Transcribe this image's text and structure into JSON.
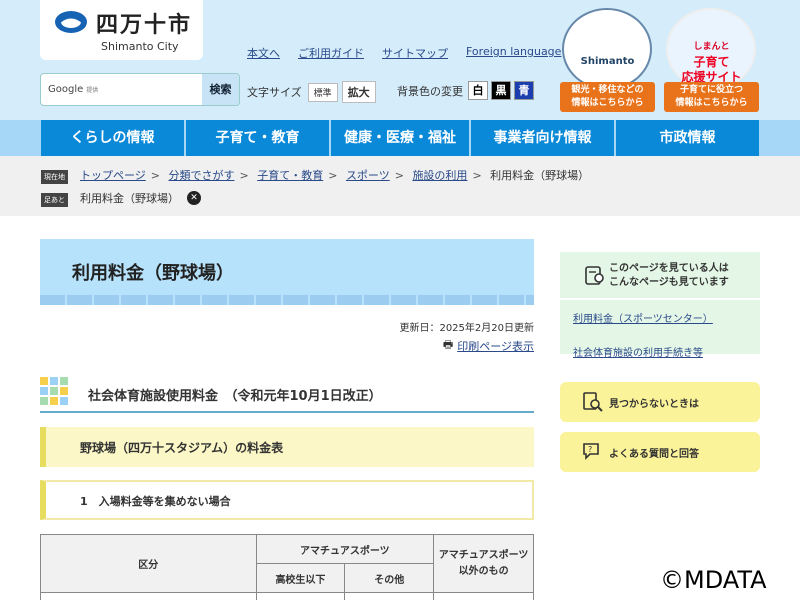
{
  "header": {
    "logo_jp": "四万十市",
    "logo_en": "Shimanto City",
    "links": [
      "本文へ",
      "ご利用ガイド",
      "サイトマップ",
      "Foreign language"
    ],
    "search_brand": "Google",
    "search_brand_sub": "提供",
    "search_button": "検索",
    "fontsize_label": "文字サイズ",
    "fontsize_normal": "標準",
    "fontsize_large": "拡大",
    "bgcolor_label": "背景色の変更",
    "bgcolor_white": "白",
    "bgcolor_black": "黒",
    "bgcolor_blue": "青",
    "banner1_line1": "観光・移住などの",
    "banner1_line2": "情報はこちらから",
    "banner1_inner": "Shimanto",
    "banner2_inner1": "しまんと",
    "banner2_inner2": "子育て",
    "banner2_inner3": "応援サイト",
    "banner2_line1": "子育てに役立つ",
    "banner2_line2": "情報はこちらから"
  },
  "nav": [
    "くらしの情報",
    "子育て・教育",
    "健康・医療・福祉",
    "事業者向け情報",
    "市政情報"
  ],
  "breadcrumb": {
    "tag_current": "現在地",
    "items": [
      "トップページ",
      "分類でさがす",
      "子育て・教育",
      "スポーツ",
      "施設の利用"
    ],
    "current": "利用料金（野球場）",
    "sep": ">",
    "tag_foot": "足あと",
    "foot_item": "利用料金（野球場）"
  },
  "main": {
    "title": "利用料金（野球場）",
    "updated": "更新日：2025年2月20日更新",
    "print": "印刷ページ表示",
    "h2": "社会体育施設使用料金　（令和元年10月1日改正）",
    "h3": "野球場（四万十スタジアム）の料金表",
    "h4": "1　入場料金等を集めない場合",
    "table": {
      "col_kubun": "区分",
      "col_amateur": "アマチュアスポーツ",
      "col_high": "高校生以下",
      "col_other": "その他",
      "col_non_amateur": "アマチュアスポーツ以外のもの"
    }
  },
  "side": {
    "related_heading": "このページを見ている人はこんなページも見ています",
    "related_line1": "このページを見ている人は",
    "related_line2": "こんなページも見ています",
    "links": [
      "利用料金（スポーツセンター）",
      "社会体育施設の利用手続き等"
    ],
    "notfound": "見つからないときは",
    "faq": "よくある質問と回答"
  },
  "watermark": "©MDATA"
}
